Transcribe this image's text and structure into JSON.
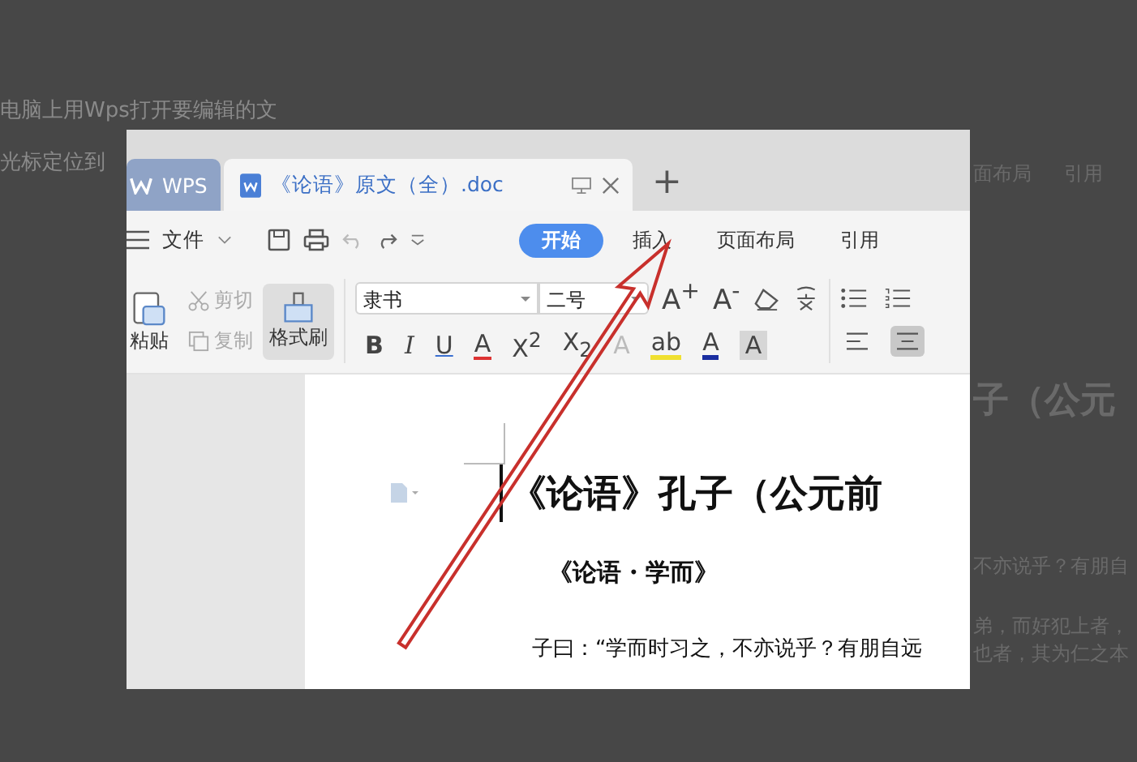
{
  "background": {
    "lines": [
      "电脑上用Wps打开要编辑的文",
      "光标定位到"
    ],
    "right_fragments": [
      "面布局",
      "引用",
      "子（公元",
      "不亦说乎？有朋自",
      "弟，而好犯上者，",
      "也者，其为仁之本"
    ]
  },
  "window": {
    "tabs": [
      {
        "label": "WPS",
        "kind": "home",
        "selected": false
      },
      {
        "label": "《论语》原文（全）.doc",
        "kind": "doc",
        "selected": true
      }
    ],
    "new_tab": "+",
    "file_menu": "文件",
    "ribbon_tabs": [
      {
        "label": "开始",
        "selected": true
      },
      {
        "label": "插入",
        "selected": false
      },
      {
        "label": "页面布局",
        "selected": false
      },
      {
        "label": "引用",
        "selected": false
      }
    ],
    "clipboard": [
      {
        "label": "粘贴",
        "kind": "paste",
        "disabled": false
      },
      {
        "label": "剪切",
        "kind": "cut",
        "disabled": true
      },
      {
        "label": "复制",
        "kind": "copy",
        "disabled": true
      },
      {
        "label": "格式刷",
        "kind": "painter",
        "disabled": false
      }
    ],
    "font": {
      "name": "隶书",
      "size": "二号",
      "grow": "A$^{+}$",
      "shrink": "A$^{-}$"
    },
    "format_buttons": [
      {
        "label": "B",
        "kind": "bold"
      },
      {
        "label": "I",
        "kind": "italic"
      },
      {
        "label": "U",
        "kind": "underline"
      },
      {
        "label": "A",
        "kind": "strike"
      },
      {
        "label": "X$^{2}$",
        "kind": "sup"
      },
      {
        "label": "X$_{2}$",
        "kind": "sub"
      },
      {
        "label": "A",
        "kind": "effect"
      },
      {
        "label": "ab",
        "kind": "highlight"
      },
      {
        "label": "A",
        "kind": "color"
      },
      {
        "label": "A",
        "kind": "shade"
      }
    ],
    "align_buttons": [
      {
        "kind": "left",
        "selected": false
      },
      {
        "kind": "center",
        "selected": true
      }
    ]
  },
  "document": {
    "title": "《论语》孔子（公元前",
    "subtitle": "《论语・学而》",
    "line": "子曰：“学而时习之，不亦说乎？有朋自远"
  }
}
